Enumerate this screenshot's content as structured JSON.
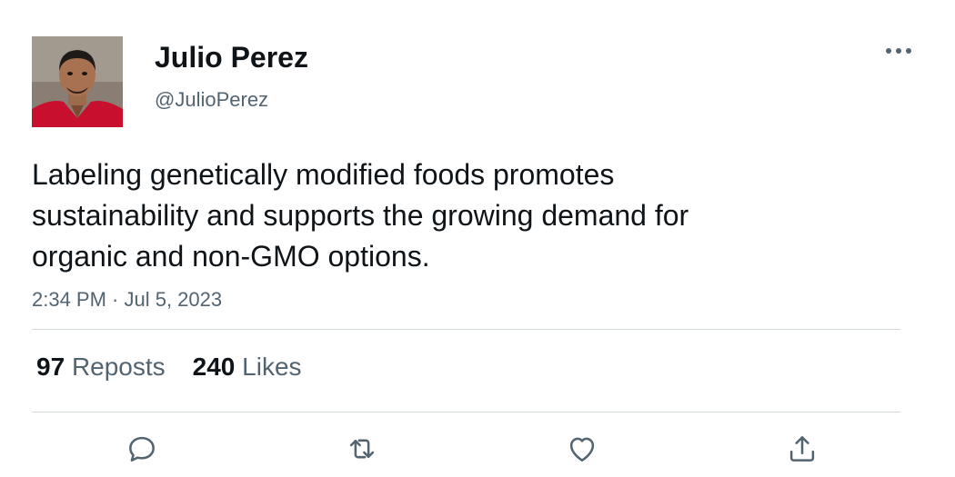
{
  "author": {
    "name": "Julio Perez",
    "handle": "@JulioPerez",
    "avatar_icon": "profile-photo"
  },
  "tweet": {
    "lines": [
      "Labeling genetically modified foods promotes",
      "sustainability and supports the growing demand for",
      "organic and non-GMO options."
    ],
    "timestamp": "2:34 PM · Jul 5, 2023"
  },
  "stats": {
    "reposts_count": "97",
    "reposts_label": "Reposts",
    "likes_count": "240",
    "likes_label": "Likes"
  },
  "actions": [
    "reply-icon",
    "repost-icon",
    "like-icon",
    "share-icon"
  ],
  "colors": {
    "text": "#0f1419",
    "secondary": "#536471",
    "divider": "#cfd9de"
  }
}
